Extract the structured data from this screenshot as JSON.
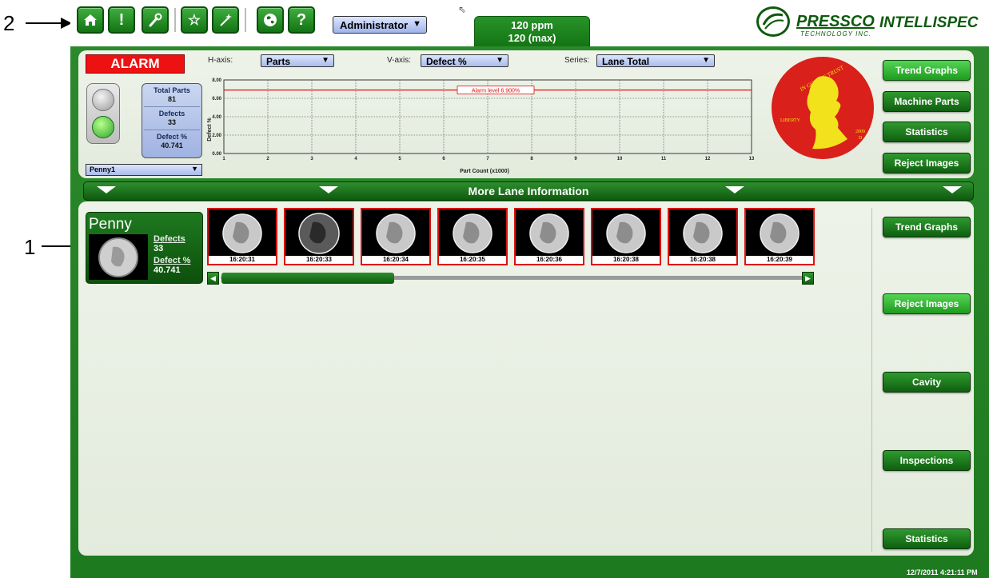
{
  "callouts": {
    "label_1": "1",
    "label_2": "2"
  },
  "toolbar": {
    "icons": [
      "home-icon",
      "alert-icon",
      "wrench-icon",
      "star-icon",
      "wand-icon",
      "globe-icon",
      "help-icon"
    ],
    "user_role": "Administrator",
    "rate_line1": "120 ppm",
    "rate_line2": "120 (max)"
  },
  "brand": {
    "company": "PRESSCO",
    "company_sub": "TECHNOLOGY INC.",
    "product": "INTELLISPEC"
  },
  "status": {
    "alarm": "ALARM",
    "total_parts_label": "Total Parts",
    "total_parts_value": "81",
    "defects_label": "Defects",
    "defects_value": "33",
    "defect_pct_label": "Defect %",
    "defect_pct_value": "40.741",
    "lane": "Penny1"
  },
  "graph_controls": {
    "h_axis_label": "H-axis:",
    "h_axis_value": "Parts",
    "v_axis_label": "V-axis:",
    "v_axis_value": "Defect %",
    "series_label": "Series:",
    "series_value": "Lane Total"
  },
  "chart_data": {
    "type": "line",
    "xlabel": "Part Count (x1000)",
    "ylabel": "Defect %",
    "x_ticks": [
      "1",
      "2",
      "3",
      "4",
      "5",
      "6",
      "7",
      "8",
      "9",
      "10",
      "11",
      "12",
      "13"
    ],
    "y_ticks": [
      "0.00",
      "2.00",
      "4.00",
      "6.00",
      "8.00"
    ],
    "xlim": [
      1,
      13
    ],
    "ylim": [
      0,
      8
    ],
    "grid": true,
    "alarm_level": 6.9,
    "alarm_label": "Alarm level 6.900%",
    "alarm_color": "#e01010"
  },
  "coin": {
    "motto": "IN GOD WE TRUST",
    "left_text": "LIBERTY",
    "year": "2009",
    "mint": "D",
    "rim_color": "#d9201a",
    "portrait_color": "#f2e21c"
  },
  "top_nav": [
    "Trend Graphs",
    "Machine Parts",
    "Statistics",
    "Reject Images"
  ],
  "lane_bar": {
    "title": "More Lane Information"
  },
  "lane_card": {
    "name": "Penny",
    "defects_label": "Defects",
    "defects_value": "33",
    "defect_pct_label": "Defect %",
    "defect_pct_value": "40.741"
  },
  "reject_images": [
    {
      "time": "16:20:31"
    },
    {
      "time": "16:20:33"
    },
    {
      "time": "16:20:34"
    },
    {
      "time": "16:20:35"
    },
    {
      "time": "16:20:36"
    },
    {
      "time": "16:20:38"
    },
    {
      "time": "16:20:38"
    },
    {
      "time": "16:20:39"
    }
  ],
  "side_nav": [
    "Trend Graphs",
    "Reject Images",
    "Cavity",
    "Inspections",
    "Statistics"
  ],
  "footer": {
    "timestamp": "12/7/2011 4:21:11 PM"
  }
}
